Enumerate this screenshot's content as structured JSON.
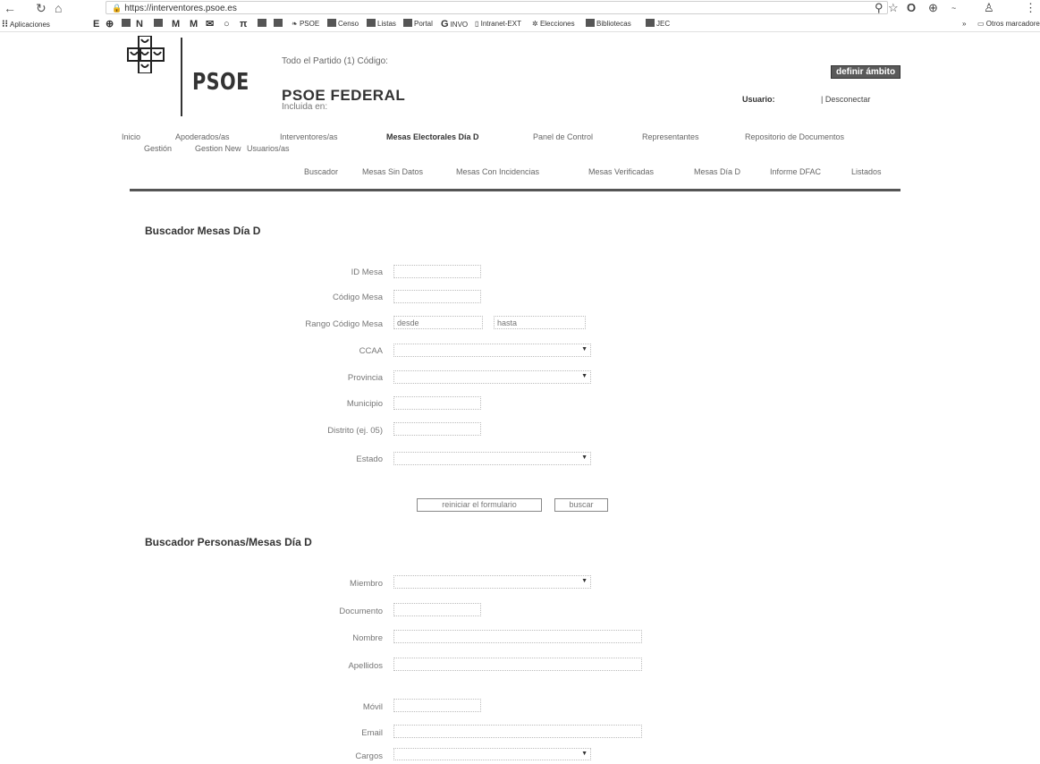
{
  "browser": {
    "url": "https://interventores.psoe.es",
    "bookmarks": [
      "Aplicaciones",
      "PSOE",
      "Censo",
      "Listas",
      "Portal",
      "INVO",
      "Intranet-EXT",
      "Elecciones",
      "Bibliotecas",
      "JEC",
      "Otros marcadores"
    ]
  },
  "header": {
    "logo_text": "PSOE",
    "scope_line": "Todo el Partido (1) Código:",
    "org_title": "PSOE FEDERAL",
    "included_line": "Incluida en:",
    "define_scope": "definir ámbito",
    "user_label": "Usuario:",
    "logout": "| Desconectar"
  },
  "menu": {
    "row1": [
      "Inicio",
      "Apoderados/as",
      "Interventores/as",
      "Mesas Electorales Día D",
      "Panel de Control",
      "Representantes",
      "Repositorio de Documentos"
    ],
    "row2": [
      "Gestión",
      "Gestion New",
      "Usuarios/as"
    ],
    "submenu": [
      "Buscador",
      "Mesas Sin Datos",
      "Mesas Con Incidencias",
      "Mesas Verificadas",
      "Mesas Día D",
      "Informe DFAC",
      "Listados"
    ]
  },
  "search_tables": {
    "title": "Buscador Mesas Día D",
    "fields": {
      "id_mesa": "ID Mesa",
      "codigo_mesa": "Código Mesa",
      "rango_codigo": "Rango Código Mesa",
      "desde_placeholder": "desde",
      "hasta_placeholder": "hasta",
      "ccaa": "CCAA",
      "provincia": "Provincia",
      "municipio": "Municipio",
      "distrito": "Distrito (ej. 05)",
      "estado": "Estado"
    },
    "reset_button": "reiniciar el formulario",
    "search_button": "buscar"
  },
  "search_people": {
    "title": "Buscador Personas/Mesas Día D",
    "fields": {
      "miembro": "Miembro",
      "documento": "Documento",
      "nombre": "Nombre",
      "apellidos": "Apellidos",
      "movil": "Móvil",
      "email": "Email",
      "cargos": "Cargos"
    }
  }
}
